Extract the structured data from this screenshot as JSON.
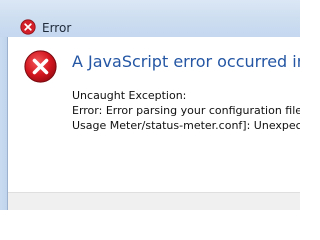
{
  "window": {
    "title": "Error",
    "title_icon": "error-icon-small",
    "accent": "#2456a4",
    "error_color": "#c8102e"
  },
  "dialog": {
    "icon": "error-icon",
    "heading": "A JavaScript error occurred in the",
    "lines": [
      "Uncaught Exception:",
      "Error: Error parsing your configuration file:",
      "Usage Meter/status-meter.conf]: Unexpected"
    ]
  }
}
